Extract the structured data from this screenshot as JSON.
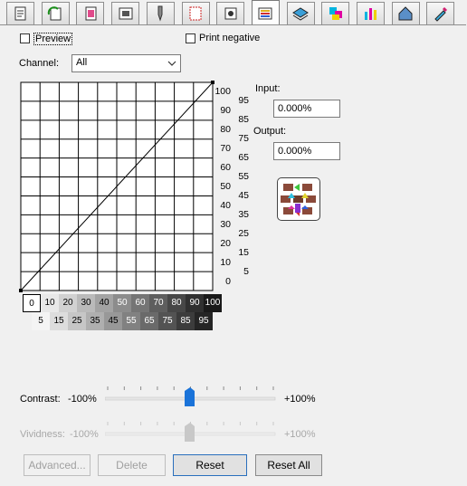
{
  "tabs": [
    {
      "icon": "printer-paper-icon",
      "active": false
    },
    {
      "icon": "page-rotate-icon",
      "active": false
    },
    {
      "icon": "color-page-icon",
      "active": false
    },
    {
      "icon": "film-frame-icon",
      "active": false
    },
    {
      "icon": "ink-pen-icon",
      "active": false
    },
    {
      "icon": "bleed-marks-icon",
      "active": false
    },
    {
      "icon": "crop-target-icon",
      "active": false
    },
    {
      "icon": "color-adjust-icon",
      "active": true
    },
    {
      "icon": "layers-stack-icon",
      "active": false
    },
    {
      "icon": "cmyk-squares-icon",
      "active": false
    },
    {
      "icon": "ink-bars-icon",
      "active": false
    },
    {
      "icon": "color-house-icon",
      "active": false
    },
    {
      "icon": "eyedropper-icon",
      "active": false
    }
  ],
  "preview": {
    "label": "Preview",
    "checked": false
  },
  "print_negative": {
    "label": "Print negative",
    "checked": false
  },
  "channel": {
    "label": "Channel:",
    "value": "All"
  },
  "curve": {
    "left_ticks": [
      "100",
      "90",
      "80",
      "70",
      "60",
      "50",
      "40",
      "30",
      "20",
      "10",
      "0"
    ],
    "right_ticks": [
      "95",
      "85",
      "75",
      "65",
      "55",
      "45",
      "35",
      "25",
      "15",
      "5"
    ],
    "points": [
      [
        0,
        0
      ],
      [
        100,
        100
      ]
    ]
  },
  "input": {
    "label": "Input:",
    "value": "0.000%"
  },
  "output": {
    "label": "Output:",
    "value": "0.000%"
  },
  "swatches_top": [
    "0",
    "10",
    "20",
    "30",
    "40",
    "50",
    "60",
    "70",
    "80",
    "90",
    "100"
  ],
  "swatches_bottom": [
    "5",
    "15",
    "25",
    "35",
    "45",
    "55",
    "65",
    "75",
    "85",
    "95"
  ],
  "contrast": {
    "label": "Contrast:",
    "min": "-100%",
    "max": "+100%",
    "value": 0
  },
  "vividness": {
    "label": "Vividness:",
    "min": "-100%",
    "max": "+100%",
    "value": 0,
    "enabled": false
  },
  "buttons": {
    "advanced": "Advanced...",
    "delete": "Delete",
    "reset": "Reset",
    "reset_all": "Reset All"
  }
}
